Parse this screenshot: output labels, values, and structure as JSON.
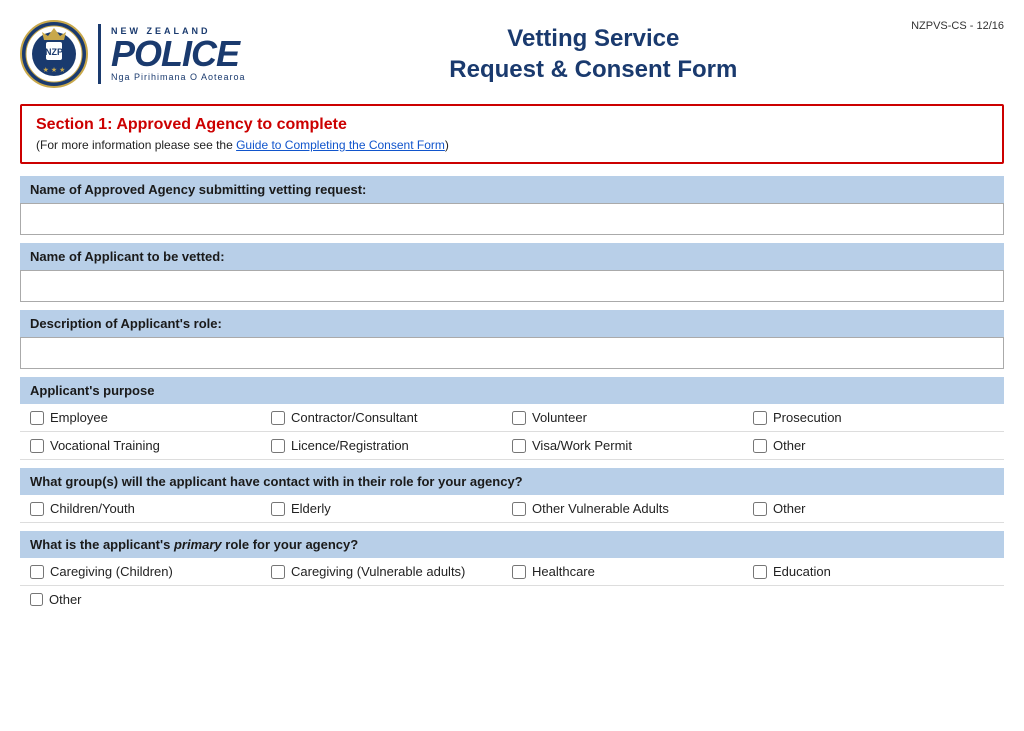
{
  "header": {
    "ref": "NZPVS-CS - 12/16",
    "title_line1": "Vetting Service",
    "title_line2": "Request & Consent Form",
    "logo_nz": "NEW ZEALAND",
    "logo_police": "POLICE",
    "logo_maori": "Nga Pirihimana O Aotearoa"
  },
  "section1": {
    "title": "Section 1:  Approved Agency to complete",
    "subtitle_pre": "(For more information please see the ",
    "subtitle_link": "Guide to Completing the Consent Form",
    "subtitle_post": ")"
  },
  "fields": {
    "agency_label": "Name of Approved Agency submitting vetting request:",
    "applicant_label": "Name of Applicant to be vetted:",
    "role_label": "Description of Applicant's role:"
  },
  "purpose": {
    "label": "Applicant's purpose",
    "row1": [
      "Employee",
      "Contractor/Consultant",
      "Volunteer",
      "Prosecution"
    ],
    "row2": [
      "Vocational Training",
      "Licence/Registration",
      "Visa/Work Permit",
      "Other"
    ]
  },
  "groups": {
    "label": "What group(s) will the applicant have contact with in their role for your agency?",
    "items": [
      "Children/Youth",
      "Elderly",
      "Other Vulnerable Adults",
      "Other"
    ]
  },
  "primary_role": {
    "label_pre": "What is the applicant's ",
    "label_em": "primary",
    "label_post": " role for your agency?",
    "row1": [
      "Caregiving (Children)",
      "Caregiving (Vulnerable adults)",
      "Healthcare",
      "Education"
    ],
    "row2_single": "Other"
  }
}
